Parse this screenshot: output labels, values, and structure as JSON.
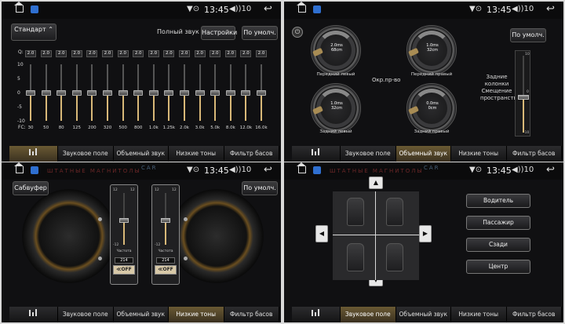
{
  "status": {
    "time": "13:45",
    "volume": "10",
    "signal": "▼⊙",
    "vol_icon": "◀))"
  },
  "tabs": [
    "Звуковое поле",
    "Объемный звук",
    "Низкие тоны",
    "Фильтр басов"
  ],
  "eq": {
    "preset": "Стандарт",
    "q_label": "Q:",
    "fc_label": "FC:",
    "full_sound": "Полный звук",
    "settings_btn": "Настройки",
    "default_btn": "По умолч.",
    "q_values": [
      "2.0",
      "2.0",
      "2.0",
      "2.0",
      "2.0",
      "2.0",
      "2.0",
      "2.0",
      "2.0",
      "2.0",
      "2.0",
      "2.0",
      "2.0",
      "2.0",
      "2.0",
      "2.0"
    ],
    "freqs": [
      "30",
      "50",
      "80",
      "125",
      "200",
      "320",
      "500",
      "800",
      "1.0k",
      "1.25k",
      "2.0k",
      "3.0k",
      "5.0k",
      "8.0k",
      "12.0k",
      "16.0k"
    ],
    "levels": [
      0,
      0,
      0,
      0,
      0,
      0,
      0,
      0,
      0,
      0,
      0,
      0,
      0,
      0,
      0,
      0
    ],
    "scale": [
      "10",
      "5",
      "0",
      "-5",
      "-10"
    ]
  },
  "field": {
    "default_btn": "По умолч.",
    "center_label": "Окр.пр-во",
    "rear_label": "Задние колонки Смещение пространства",
    "gauges": [
      {
        "value": "2.0ms",
        "dist": "68cm",
        "caption": "Передний левый"
      },
      {
        "value": "1.0ms",
        "dist": "32cm",
        "caption": "Передний правый"
      },
      {
        "value": "1.0ms",
        "dist": "32cm",
        "caption": "Задний левый"
      },
      {
        "value": "0.0ms",
        "dist": "0cm",
        "caption": "Задний правый"
      }
    ],
    "gauge_scale": [
      "100",
      "125",
      "150"
    ],
    "bal_ticks": [
      "10",
      "0",
      "-10"
    ]
  },
  "bass": {
    "subwoofer_btn": "Сабвуфер",
    "default_btn": "По умолч.",
    "slider_caption": "Частота",
    "sub_value": "214",
    "off_label": "≪OFF",
    "ticks": [
      "12",
      "0",
      "-12"
    ]
  },
  "position": {
    "buttons": [
      "Водитель",
      "Пассажир",
      "Сзади",
      "Центр"
    ]
  },
  "watermark": "ШТАТНЫЕ МАГНИТОЛЫ",
  "watermark_logo": "CAR"
}
